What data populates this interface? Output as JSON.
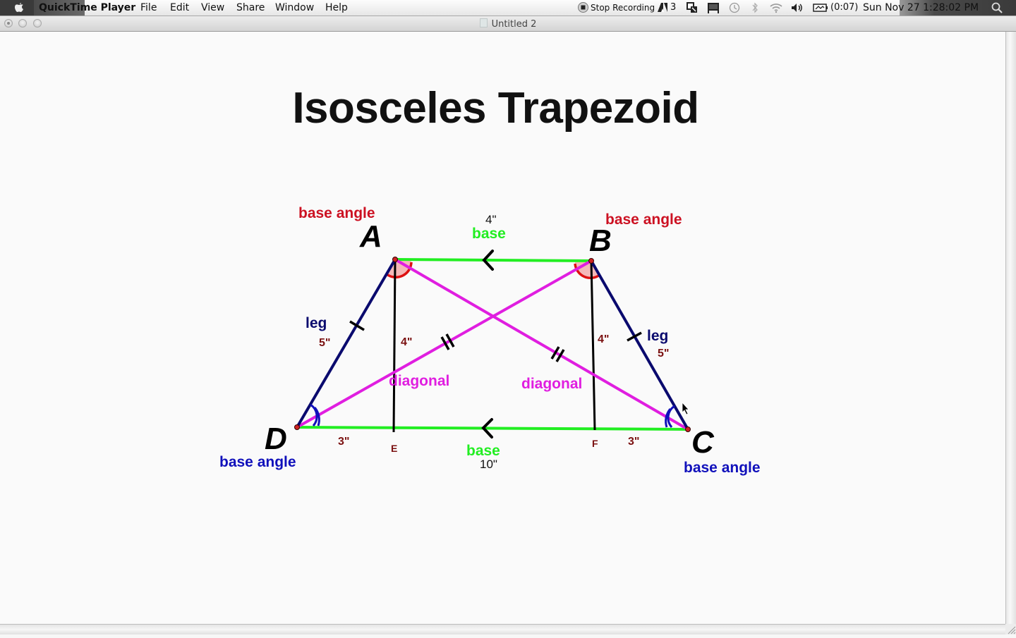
{
  "menubar": {
    "app_name": "QuickTime Player",
    "menus": [
      "File",
      "Edit",
      "View",
      "Share",
      "Window",
      "Help"
    ],
    "status": {
      "recording_label": "Stop Recording",
      "adobe_count": "3",
      "battery_time": "(0:07)",
      "clock": "Sun Nov 27  1:28:02 PM"
    },
    "icons": [
      "apple-icon",
      "stop-recording-icon",
      "adobe-icon",
      "screen-sharing-icon",
      "display-icon",
      "time-machine-icon",
      "bluetooth-icon",
      "wifi-icon",
      "volume-icon",
      "battery-icon",
      "spotlight-icon"
    ]
  },
  "window": {
    "title": "Untitled 2",
    "buttons": [
      "close",
      "minimize",
      "zoom"
    ]
  },
  "slide": {
    "title": "Isosceles Trapezoid",
    "vertices": {
      "A": "A",
      "B": "B",
      "C": "C",
      "D": "D"
    },
    "foot_points": {
      "E": "E",
      "F": "F"
    },
    "labels": {
      "base_angle_a": "base angle",
      "base_angle_b": "base angle",
      "base_angle_c": "base angle",
      "base_angle_d": "base angle",
      "top_base": "base",
      "top_base_length": "4\"",
      "bottom_base": "base",
      "bottom_base_length": "10\"",
      "leg_left": "leg",
      "leg_left_length": "5\"",
      "leg_right": "leg",
      "leg_right_length": "5\"",
      "height_left": "4\"",
      "height_right": "4\"",
      "diagonal_left": "diagonal",
      "diagonal_right": "diagonal",
      "segment_de": "3\"",
      "segment_fc": "3\""
    },
    "colors": {
      "base": "#22ee22",
      "leg": "#0a0a6e",
      "diagonal": "#e01ee0",
      "height": "#000000",
      "top_angle_label": "#cc1122",
      "bottom_angle_label": "#1010bb",
      "measure": "#7a1010",
      "vertex_point": "#cc2222"
    }
  }
}
